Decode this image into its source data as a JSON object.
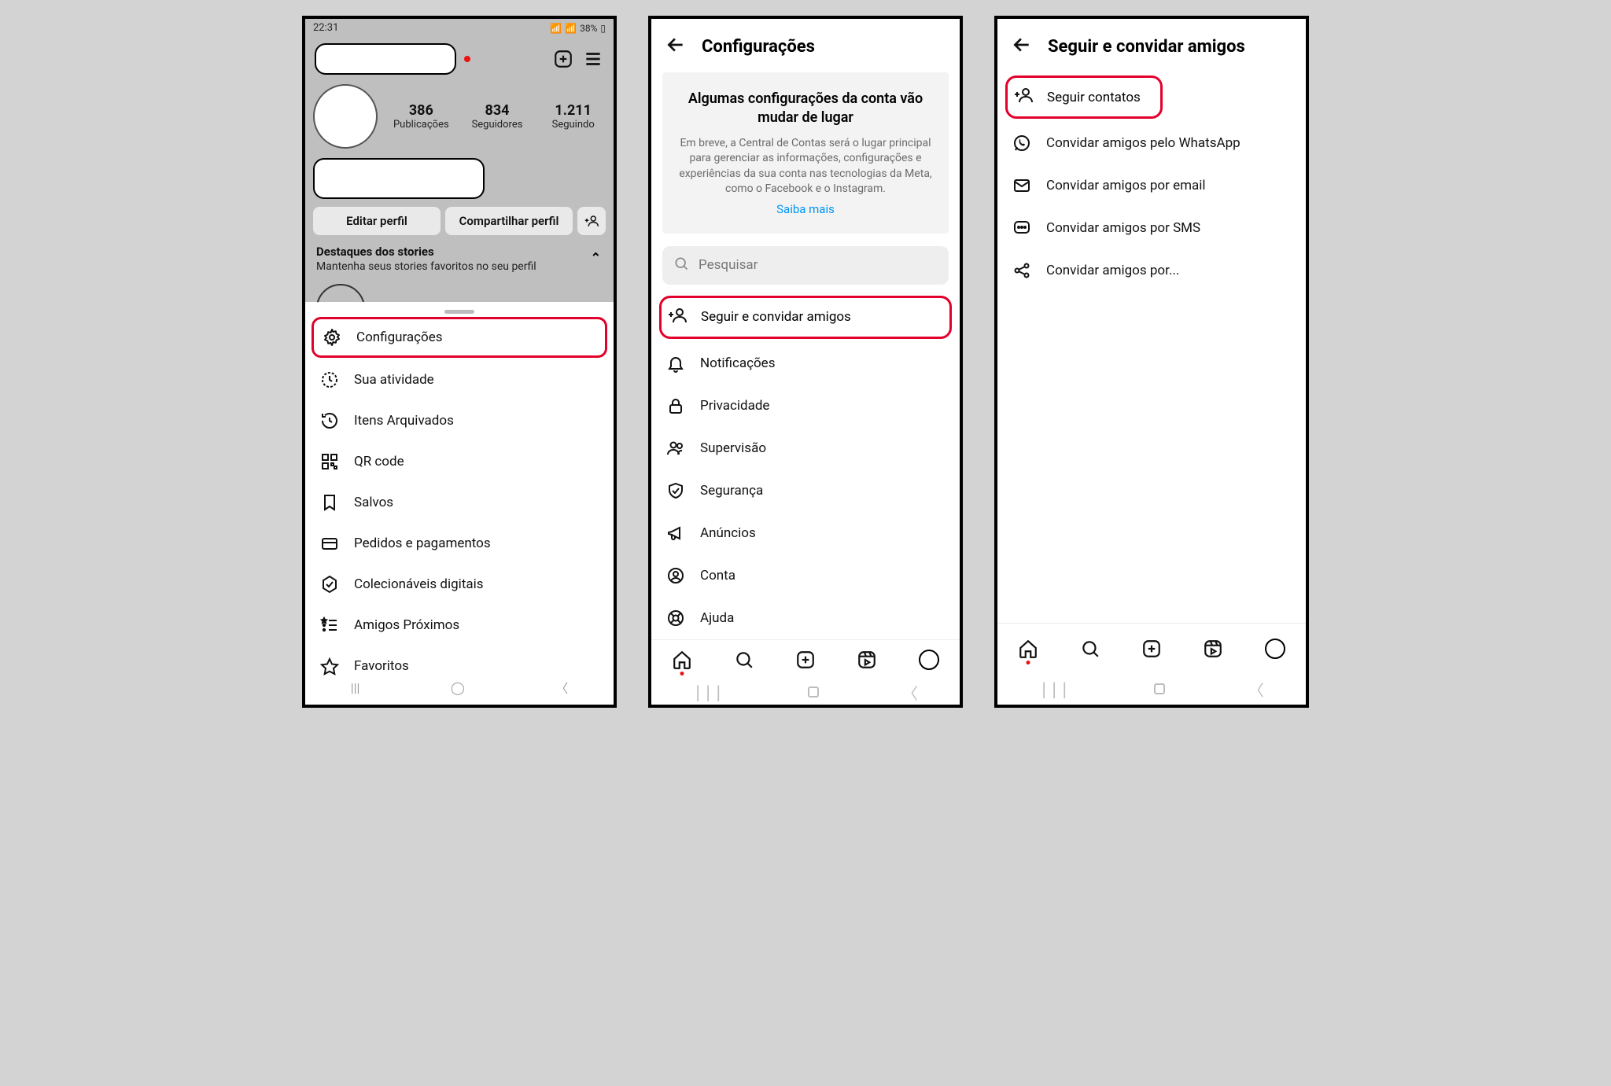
{
  "screen1": {
    "statusbar": {
      "time": "22:31",
      "battery": "38%"
    },
    "stats": {
      "posts": {
        "num": "386",
        "label": "Publicações"
      },
      "followers": {
        "num": "834",
        "label": "Seguidores"
      },
      "following": {
        "num": "1.211",
        "label": "Seguindo"
      }
    },
    "buttons": {
      "edit": "Editar perfil",
      "share": "Compartilhar perfil"
    },
    "highlights": {
      "title": "Destaques dos stories",
      "sub": "Mantenha seus stories favoritos no seu perfil"
    },
    "sheet": [
      "Configurações",
      "Sua atividade",
      "Itens Arquivados",
      "QR code",
      "Salvos",
      "Pedidos e pagamentos",
      "Colecionáveis digitais",
      "Amigos Próximos",
      "Favoritos"
    ]
  },
  "screen2": {
    "title": "Configurações",
    "info": {
      "title": "Algumas configurações da conta vão mudar de lugar",
      "body": "Em breve, a Central de Contas será o lugar principal para gerenciar as informações, configurações e experiências da sua conta nas tecnologias da Meta, como o Facebook e o Instagram.",
      "link": "Saiba mais"
    },
    "search_placeholder": "Pesquisar",
    "items": [
      "Seguir e convidar amigos",
      "Notificações",
      "Privacidade",
      "Supervisão",
      "Segurança",
      "Anúncios",
      "Conta",
      "Ajuda"
    ]
  },
  "screen3": {
    "title": "Seguir e convidar amigos",
    "items": [
      "Seguir contatos",
      "Convidar amigos pelo WhatsApp",
      "Convidar amigos por email",
      "Convidar amigos por SMS",
      "Convidar amigos por..."
    ]
  }
}
